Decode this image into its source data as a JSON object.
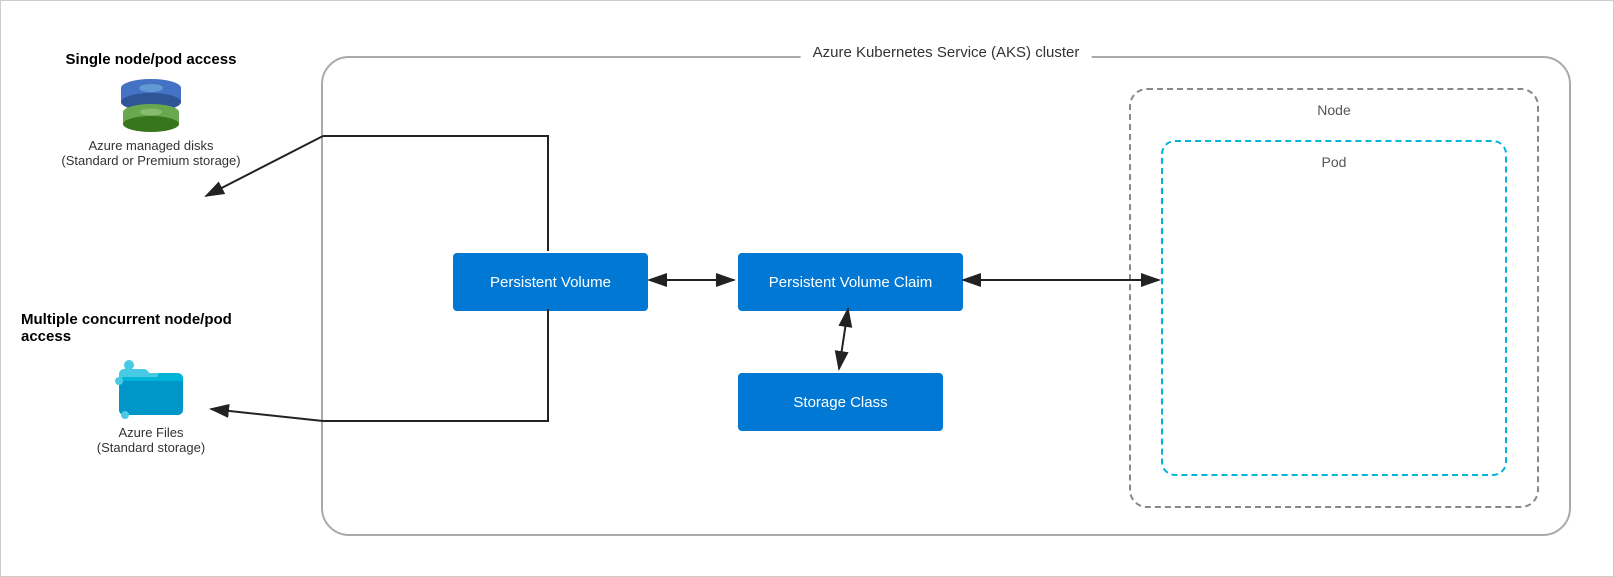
{
  "diagram": {
    "title": "Azure Kubernetes Service (AKS) cluster",
    "node_label": "Node",
    "pod_label": "Pod",
    "persistent_volume_label": "Persistent Volume",
    "persistent_volume_claim_label": "Persistent Volume Claim",
    "storage_class_label": "Storage Class",
    "single_access_label": "Single node/pod access",
    "managed_disks_label": "Azure managed disks",
    "managed_disks_sub": "(Standard or Premium storage)",
    "multi_access_label": "Multiple concurrent node/pod access",
    "azure_files_label": "Azure Files",
    "azure_files_sub": "(Standard storage)"
  }
}
